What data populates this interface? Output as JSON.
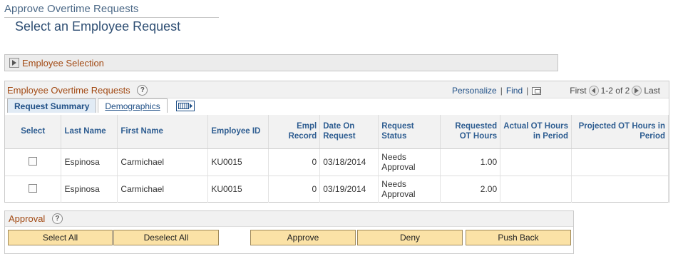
{
  "header": {
    "app_title": "Approve Overtime Requests",
    "page_title": "Select an Employee Request"
  },
  "employee_selection": {
    "label": "Employee Selection"
  },
  "grid": {
    "title": "Employee Overtime Requests",
    "personalize": "Personalize",
    "find": "Find",
    "separator": "|",
    "first": "First",
    "range": "1-2 of 2",
    "last": "Last",
    "tabs": [
      "Request Summary",
      "Demographics"
    ],
    "columns": {
      "select": "Select",
      "last_name": "Last Name",
      "first_name": "First Name",
      "employee_id": "Employee ID",
      "empl_record": "Empl Record",
      "date_on_request": "Date On Request",
      "request_status": "Request Status",
      "requested_ot_hours": "Requested OT Hours",
      "actual_ot_hours": "Actual OT Hours in Period",
      "projected_ot_hours": "Projected OT Hours in Period"
    },
    "rows": [
      {
        "last_name": "Espinosa",
        "first_name": "Carmichael",
        "employee_id": "KU0015",
        "empl_record": "0",
        "date": "03/18/2014",
        "status": "Needs Approval",
        "requested": "1.00",
        "actual": "",
        "projected": ""
      },
      {
        "last_name": "Espinosa",
        "first_name": "Carmichael",
        "employee_id": "KU0015",
        "empl_record": "0",
        "date": "03/19/2014",
        "status": "Needs Approval",
        "requested": "2.00",
        "actual": "",
        "projected": ""
      }
    ]
  },
  "approval": {
    "title": "Approval",
    "buttons": {
      "select_all": "Select All",
      "deselect_all": "Deselect All",
      "approve": "Approve",
      "deny": "Deny",
      "push_back": "Push Back"
    }
  },
  "colors": {
    "section_label": "#a24a14",
    "link": "#1f4f86",
    "button_bg": "#fbe2a6"
  },
  "icons": [
    "expand-triangle-icon",
    "help-icon",
    "zoom-grid-icon",
    "previous-arrow-icon",
    "next-arrow-icon",
    "show-all-columns-icon",
    "checkbox-icon"
  ]
}
